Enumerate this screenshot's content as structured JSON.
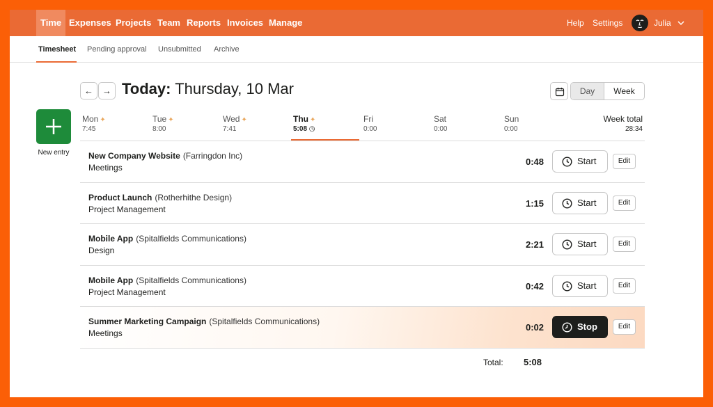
{
  "colors": {
    "frame": "#fb5f07",
    "topnav": "#ea6a34",
    "accent": "#ea6a34",
    "new_entry": "#1e8b3a",
    "stop_button": "#1d1e1c"
  },
  "topnav": {
    "items": [
      "Time",
      "Expenses",
      "Projects",
      "Team",
      "Reports",
      "Invoices",
      "Manage"
    ],
    "active": "Time",
    "help": "Help",
    "settings": "Settings",
    "user": "Julia"
  },
  "subnav": {
    "items": [
      "Timesheet",
      "Pending approval",
      "Unsubmitted",
      "Archive"
    ],
    "active": "Timesheet"
  },
  "header": {
    "today_label": "Today:",
    "date": "Thursday, 10 Mar",
    "view_day": "Day",
    "view_week": "Week",
    "active_view": "Day"
  },
  "new_entry": {
    "label": "New entry"
  },
  "days": [
    {
      "name": "Mon",
      "time": "7:45"
    },
    {
      "name": "Tue",
      "time": "8:00"
    },
    {
      "name": "Wed",
      "time": "7:41"
    },
    {
      "name": "Thu",
      "time": "5:08"
    },
    {
      "name": "Fri",
      "time": "0:00"
    },
    {
      "name": "Sat",
      "time": "0:00"
    },
    {
      "name": "Sun",
      "time": "0:00"
    }
  ],
  "active_day": "Thu",
  "week_total": {
    "label": "Week total",
    "value": "28:34"
  },
  "entries": [
    {
      "project": "New Company Website",
      "client": "(Farringdon Inc)",
      "task": "Meetings",
      "duration": "0:48",
      "action": "Start",
      "edit": "Edit"
    },
    {
      "project": "Product Launch",
      "client": "(Rotherhithe Design)",
      "task": "Project Management",
      "duration": "1:15",
      "action": "Start",
      "edit": "Edit"
    },
    {
      "project": "Mobile App",
      "client": "(Spitalfields Communications)",
      "task": "Design",
      "duration": "2:21",
      "action": "Start",
      "edit": "Edit"
    },
    {
      "project": "Mobile App",
      "client": "(Spitalfields Communications)",
      "task": "Project Management",
      "duration": "0:42",
      "action": "Start",
      "edit": "Edit"
    },
    {
      "project": "Summer Marketing Campaign",
      "client": "(Spitalfields Communications)",
      "task": "Meetings",
      "duration": "0:02",
      "action": "Stop",
      "edit": "Edit"
    }
  ],
  "total": {
    "label": "Total:",
    "value": "5:08"
  }
}
